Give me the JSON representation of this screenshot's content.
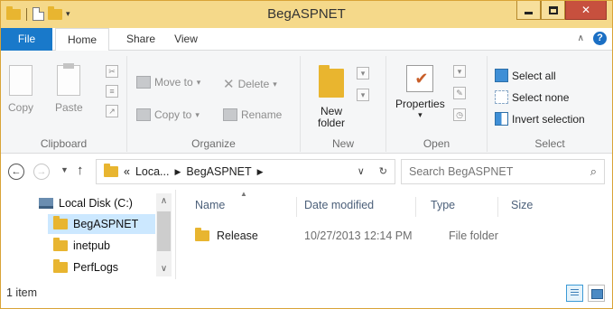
{
  "window": {
    "title": "BegASPNET"
  },
  "ribbon_tabs": [
    "File",
    "Home",
    "Share",
    "View"
  ],
  "ribbon": {
    "clipboard": {
      "copy": "Copy",
      "paste": "Paste",
      "label": "Clipboard"
    },
    "organize": {
      "move_to": "Move to",
      "copy_to": "Copy to",
      "delete": "Delete",
      "rename": "Rename",
      "label": "Organize"
    },
    "new": {
      "new_folder": "New folder",
      "label": "New"
    },
    "open": {
      "properties": "Properties",
      "label": "Open"
    },
    "select": {
      "select_all": "Select all",
      "select_none": "Select none",
      "invert_selection": "Invert selection",
      "label": "Select"
    }
  },
  "address": {
    "prefix": "«",
    "crumb1": "Loca...",
    "crumb2": "BegASPNET",
    "search_placeholder": "Search BegASPNET"
  },
  "nav_pane": {
    "items": [
      {
        "label": "Local Disk (C:)",
        "icon": "drive-icon"
      },
      {
        "label": "BegASPNET",
        "icon": "folder-icon",
        "selected": true
      },
      {
        "label": "inetpub",
        "icon": "folder-icon"
      },
      {
        "label": "PerfLogs",
        "icon": "folder-icon"
      }
    ]
  },
  "content": {
    "columns": [
      "Name",
      "Date modified",
      "Type",
      "Size"
    ],
    "rows": [
      {
        "name": "Release",
        "date_modified": "10/27/2013 12:14 PM",
        "type": "File folder",
        "size": ""
      }
    ]
  },
  "status": {
    "count": "1 item"
  },
  "colors": {
    "titlebar": "#f5d98a",
    "file_tab": "#1979ca",
    "selection": "#cce8ff",
    "close": "#c7503e"
  }
}
